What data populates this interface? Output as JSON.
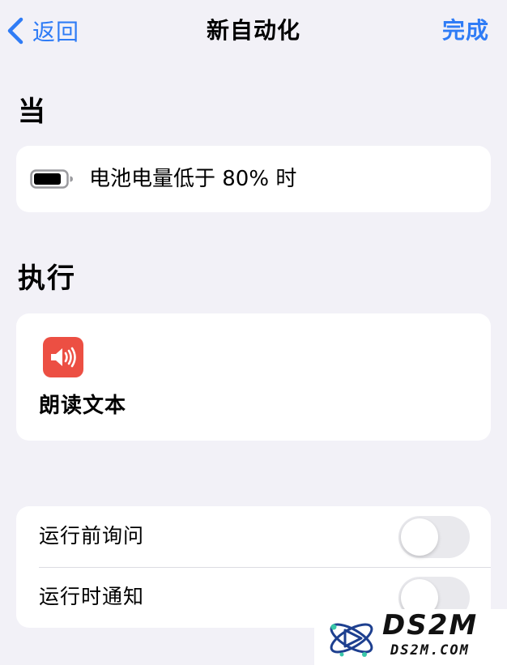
{
  "nav": {
    "back_label": "返回",
    "title": "新自动化",
    "done_label": "完成"
  },
  "trigger": {
    "heading": "当",
    "icon": "battery-icon",
    "text": "电池电量低于 80% 时"
  },
  "action": {
    "heading": "执行",
    "icon": "speaker-icon",
    "label": "朗读文本",
    "icon_color": "#ec4f43"
  },
  "options": [
    {
      "label": "运行前询问",
      "enabled": false
    },
    {
      "label": "运行时通知",
      "enabled": false
    }
  ],
  "watermark": {
    "title": "DS2M",
    "subtitle": "DS2M.COM"
  },
  "colors": {
    "accent": "#2f7cf6",
    "background": "#f2f1f7",
    "card": "#ffffff",
    "toggle_off": "#e9e9ed"
  }
}
